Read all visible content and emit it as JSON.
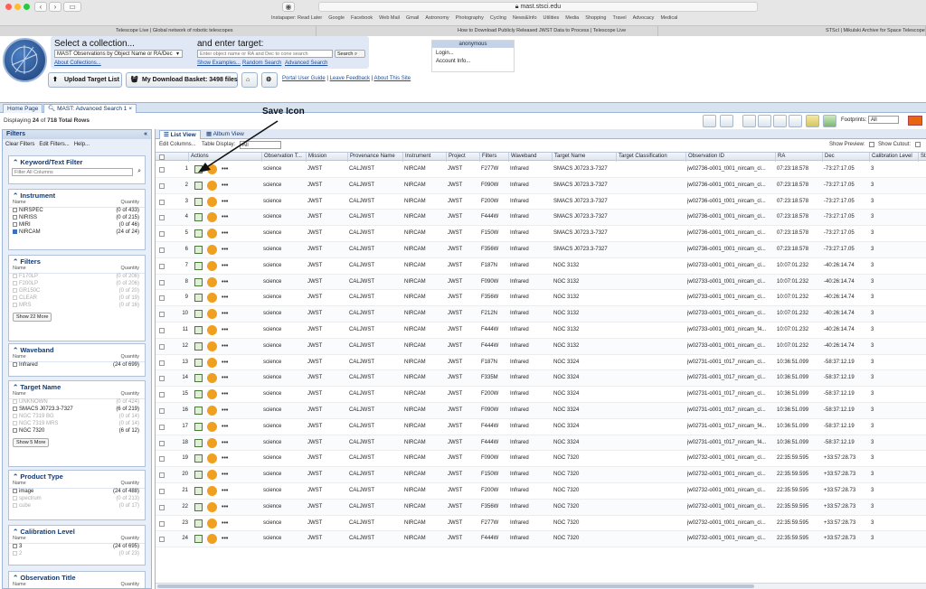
{
  "browser": {
    "url": "mast.stsci.edu",
    "bookmarks": [
      "Instapaper: Read Later",
      "Google",
      "Facebook",
      "Web Mail",
      "Gmail",
      "Astronomy",
      "Photography",
      "Cycling",
      "News&Info",
      "Utilities",
      "Media",
      "Shopping",
      "Travel",
      "Advocacy",
      "Medical"
    ],
    "tabs": [
      "Telescope Live | Global network of robotic telescopes",
      "How to Download Publicly Released JWST Data to Process | Telescope Live",
      "STScI | Mikulski Archive for Space Telescopes"
    ]
  },
  "header": {
    "collection_title": "Select a collection...",
    "collection_value": "MAST Observations by Object Name or RA/Dec",
    "about_collections": "About Collections...",
    "target_title": "and enter target:",
    "target_placeholder": "Enter object name or RA and Dec to cone search",
    "search_button": "Search",
    "show_examples": "Show Examples...",
    "random_search": "Random Search",
    "advanced_search": "Advanced Search",
    "upload_target": "Upload Target List",
    "download_basket": "My Download Basket: 3498 files",
    "portal_guide": "Portal User Guide",
    "leave_feedback": "Leave Feedback",
    "about_site": "About This Site",
    "user": {
      "name": "anonymous",
      "login": "Login...",
      "account": "Account Info..."
    }
  },
  "tabs": {
    "home": "Home Page",
    "search": "MAST: Advanced Search 1"
  },
  "rows_info": {
    "prefix": "Displaying",
    "shown": "24",
    "mid": "of",
    "total": "718 Total Rows"
  },
  "footprints": {
    "label": "Footprints:",
    "value": "All"
  },
  "filters": {
    "title": "Filters",
    "clear": "Clear Filters",
    "edit": "Edit Filters...",
    "help": "Help...",
    "keyword": {
      "title": "Keyword/Text Filter",
      "placeholder": "Filter All Columns"
    },
    "col_name": "Name",
    "col_qty": "Quantity",
    "instrument": {
      "title": "Instrument",
      "rows": [
        [
          "NIRSPEC",
          "(0 of 433)"
        ],
        [
          "NIRISS",
          "(0 of 215)"
        ],
        [
          "MIRI",
          "(0 of 46)"
        ],
        [
          "NIRCAM",
          "(24 of 24)"
        ]
      ]
    },
    "filtersec": {
      "title": "Filters",
      "rows": [
        [
          "F170LP",
          "(0 of 206)"
        ],
        [
          "F200LP",
          "(0 of 206)"
        ],
        [
          "GR150C",
          "(0 of 20)"
        ],
        [
          "CLEAR",
          "(0 of 19)"
        ],
        [
          "MRS",
          "(0 of 16)"
        ]
      ],
      "more": "Show 22 More"
    },
    "waveband": {
      "title": "Waveband",
      "rows": [
        [
          "Infrared",
          "(24 of 699)"
        ]
      ]
    },
    "target": {
      "title": "Target Name",
      "rows": [
        [
          "UNKNOWN",
          "(0 of 424)"
        ],
        [
          "SMACS J0723.3-7327",
          "(6 of 219)"
        ],
        [
          "NGC 7319 BG",
          "(0 of 14)"
        ],
        [
          "NGC 7319 MRS",
          "(0 of 14)"
        ],
        [
          "NGC 7320",
          "(6 of 12)"
        ]
      ],
      "more": "Show 5 More"
    },
    "product": {
      "title": "Product Type",
      "rows": [
        [
          "image",
          "(24 of 488)"
        ],
        [
          "spectrum",
          "(0 of 213)"
        ],
        [
          "cube",
          "(0 of 17)"
        ]
      ]
    },
    "calib": {
      "title": "Calibration Level",
      "rows": [
        [
          "3",
          "(24 of 695)"
        ],
        [
          "2",
          "(0 of 23)"
        ]
      ]
    },
    "obstitle": {
      "title": "Observation Title"
    }
  },
  "grid": {
    "list_view": "List View",
    "album_view": "Album View",
    "edit_columns": "Edit Columns...",
    "table_display": "Table Display:",
    "table_display_value": "All",
    "show_preview": "Show Preview:",
    "show_cutout": "Show Cutout:",
    "columns": [
      "Actions",
      "Observation T...",
      "Mission",
      "Provenance Name",
      "Instrument",
      "Project",
      "Filters",
      "Waveband",
      "Target Name",
      "Target Classification",
      "Observation ID",
      "RA",
      "Dec",
      "Calibration Level",
      "Sta"
    ],
    "rows": [
      [
        "1",
        "science",
        "JWST",
        "CALJWST",
        "NIRCAM",
        "JWST",
        "F277W",
        "Infrared",
        "SMACS J0723.3-7327",
        "",
        "jw02736-o001_t001_nircam_cl...",
        "07:23:18.578",
        "-73:27:17.05",
        "3"
      ],
      [
        "2",
        "science",
        "JWST",
        "CALJWST",
        "NIRCAM",
        "JWST",
        "F090W",
        "Infrared",
        "SMACS J0723.3-7327",
        "",
        "jw02736-o001_t001_nircam_cl...",
        "07:23:18.578",
        "-73:27:17.05",
        "3"
      ],
      [
        "3",
        "science",
        "JWST",
        "CALJWST",
        "NIRCAM",
        "JWST",
        "F200W",
        "Infrared",
        "SMACS J0723.3-7327",
        "",
        "jw02736-o001_t001_nircam_cl...",
        "07:23:18.578",
        "-73:27:17.05",
        "3"
      ],
      [
        "4",
        "science",
        "JWST",
        "CALJWST",
        "NIRCAM",
        "JWST",
        "F444W",
        "Infrared",
        "SMACS J0723.3-7327",
        "",
        "jw02736-o001_t001_nircam_cl...",
        "07:23:18.578",
        "-73:27:17.05",
        "3"
      ],
      [
        "5",
        "science",
        "JWST",
        "CALJWST",
        "NIRCAM",
        "JWST",
        "F150W",
        "Infrared",
        "SMACS J0723.3-7327",
        "",
        "jw02736-o001_t001_nircam_cl...",
        "07:23:18.578",
        "-73:27:17.05",
        "3"
      ],
      [
        "6",
        "science",
        "JWST",
        "CALJWST",
        "NIRCAM",
        "JWST",
        "F356W",
        "Infrared",
        "SMACS J0723.3-7327",
        "",
        "jw02736-o001_t001_nircam_cl...",
        "07:23:18.578",
        "-73:27:17.05",
        "3"
      ],
      [
        "7",
        "science",
        "JWST",
        "CALJWST",
        "NIRCAM",
        "JWST",
        "F187N",
        "Infrared",
        "NGC 3132",
        "",
        "jw02733-o001_t001_nircam_cl...",
        "10:07:01.232",
        "-40:26:14.74",
        "3"
      ],
      [
        "8",
        "science",
        "JWST",
        "CALJWST",
        "NIRCAM",
        "JWST",
        "F090W",
        "Infrared",
        "NGC 3132",
        "",
        "jw02733-o001_t001_nircam_cl...",
        "10:07:01.232",
        "-40:26:14.74",
        "3"
      ],
      [
        "9",
        "science",
        "JWST",
        "CALJWST",
        "NIRCAM",
        "JWST",
        "F356W",
        "Infrared",
        "NGC 3132",
        "",
        "jw02733-o001_t001_nircam_cl...",
        "10:07:01.232",
        "-40:26:14.74",
        "3"
      ],
      [
        "10",
        "science",
        "JWST",
        "CALJWST",
        "NIRCAM",
        "JWST",
        "F212N",
        "Infrared",
        "NGC 3132",
        "",
        "jw02733-o001_t001_nircam_cl...",
        "10:07:01.232",
        "-40:26:14.74",
        "3"
      ],
      [
        "11",
        "science",
        "JWST",
        "CALJWST",
        "NIRCAM",
        "JWST",
        "F444W",
        "Infrared",
        "NGC 3132",
        "",
        "jw02733-o001_t001_nircam_f4...",
        "10:07:01.232",
        "-40:26:14.74",
        "3"
      ],
      [
        "12",
        "science",
        "JWST",
        "CALJWST",
        "NIRCAM",
        "JWST",
        "F444W",
        "Infrared",
        "NGC 3132",
        "",
        "jw02733-o001_t001_nircam_cl...",
        "10:07:01.232",
        "-40:26:14.74",
        "3"
      ],
      [
        "13",
        "science",
        "JWST",
        "CALJWST",
        "NIRCAM",
        "JWST",
        "F187N",
        "Infrared",
        "NGC 3324",
        "",
        "jw02731-o001_t017_nircam_cl...",
        "10:36:51.099",
        "-58:37:12.19",
        "3"
      ],
      [
        "14",
        "science",
        "JWST",
        "CALJWST",
        "NIRCAM",
        "JWST",
        "F335M",
        "Infrared",
        "NGC 3324",
        "",
        "jw02731-o001_t017_nircam_cl...",
        "10:36:51.099",
        "-58:37:12.19",
        "3"
      ],
      [
        "15",
        "science",
        "JWST",
        "CALJWST",
        "NIRCAM",
        "JWST",
        "F200W",
        "Infrared",
        "NGC 3324",
        "",
        "jw02731-o001_t017_nircam_cl...",
        "10:36:51.099",
        "-58:37:12.19",
        "3"
      ],
      [
        "16",
        "science",
        "JWST",
        "CALJWST",
        "NIRCAM",
        "JWST",
        "F090W",
        "Infrared",
        "NGC 3324",
        "",
        "jw02731-o001_t017_nircam_cl...",
        "10:36:51.099",
        "-58:37:12.19",
        "3"
      ],
      [
        "17",
        "science",
        "JWST",
        "CALJWST",
        "NIRCAM",
        "JWST",
        "F444W",
        "Infrared",
        "NGC 3324",
        "",
        "jw02731-o001_t017_nircam_f4...",
        "10:36:51.099",
        "-58:37:12.19",
        "3"
      ],
      [
        "18",
        "science",
        "JWST",
        "CALJWST",
        "NIRCAM",
        "JWST",
        "F444W",
        "Infrared",
        "NGC 3324",
        "",
        "jw02731-o001_t017_nircam_f4...",
        "10:36:51.099",
        "-58:37:12.19",
        "3"
      ],
      [
        "19",
        "science",
        "JWST",
        "CALJWST",
        "NIRCAM",
        "JWST",
        "F090W",
        "Infrared",
        "NGC 7320",
        "",
        "jw02732-o001_t001_nircam_cl...",
        "22:35:59.595",
        "+33:57:28.73",
        "3"
      ],
      [
        "20",
        "science",
        "JWST",
        "CALJWST",
        "NIRCAM",
        "JWST",
        "F150W",
        "Infrared",
        "NGC 7320",
        "",
        "jw02732-o001_t001_nircam_cl...",
        "22:35:59.595",
        "+33:57:28.73",
        "3"
      ],
      [
        "21",
        "science",
        "JWST",
        "CALJWST",
        "NIRCAM",
        "JWST",
        "F200W",
        "Infrared",
        "NGC 7320",
        "",
        "jw02732-o001_t001_nircam_cl...",
        "22:35:59.595",
        "+33:57:28.73",
        "3"
      ],
      [
        "22",
        "science",
        "JWST",
        "CALJWST",
        "NIRCAM",
        "JWST",
        "F356W",
        "Infrared",
        "NGC 7320",
        "",
        "jw02732-o001_t001_nircam_cl...",
        "22:35:59.595",
        "+33:57:28.73",
        "3"
      ],
      [
        "23",
        "science",
        "JWST",
        "CALJWST",
        "NIRCAM",
        "JWST",
        "F277W",
        "Infrared",
        "NGC 7320",
        "",
        "jw02732-o001_t001_nircam_cl...",
        "22:35:59.595",
        "+33:57:28.73",
        "3"
      ],
      [
        "24",
        "science",
        "JWST",
        "CALJWST",
        "NIRCAM",
        "JWST",
        "F444W",
        "Infrared",
        "NGC 7320",
        "",
        "jw02732-o001_t001_nircam_cl...",
        "22:35:59.595",
        "+33:57:28.73",
        "3"
      ]
    ]
  },
  "annotation": "Save Icon",
  "colors": {
    "accent": "#1c4fa0",
    "panel": "#dfe8f4",
    "orange": "#f0a020"
  }
}
